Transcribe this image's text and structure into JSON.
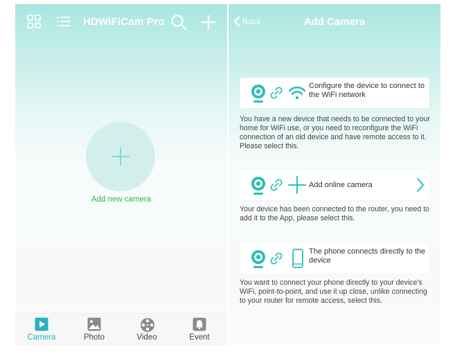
{
  "left": {
    "title": "HDWiFiCam Pro",
    "icons": [
      "grid-icon",
      "list-icon",
      "search-icon",
      "plus-icon"
    ],
    "add_label": "Add new camera",
    "tabs": [
      {
        "label": "Camera",
        "icon": "play-icon",
        "active": true
      },
      {
        "label": "Photo",
        "icon": "photo-icon",
        "active": false
      },
      {
        "label": "Video",
        "icon": "film-reel-icon",
        "active": false
      },
      {
        "label": "Event",
        "icon": "bell-icon",
        "active": false
      }
    ]
  },
  "right": {
    "back": "Back",
    "title": "Add Camera",
    "options": [
      {
        "title": "Configure the device to connect to the WiFi network",
        "icons": [
          "camera-icon",
          "link-icon",
          "wifi-icon"
        ],
        "description": "You have a new device that needs to be connected to your home for WiFi use, or you need to reconfigure the WiFi connection of an old device and have remote access to it. Please select this."
      },
      {
        "title": "Add online camera",
        "icons": [
          "camera-icon",
          "link-icon",
          "plus-icon",
          "chevron-right-icon"
        ],
        "description": "Your device has been connected to the router, you need to add it to the App, please select this."
      },
      {
        "title": "The phone connects directly to the device",
        "icons": [
          "camera-icon",
          "link-icon",
          "phone-icon"
        ],
        "description": "You want to connect your phone directly to your device's WiFi, point-to-point, and use it up close, unlike connecting to your router for remote access, select this."
      }
    ]
  },
  "colors": {
    "accent": "#27b0c5",
    "header": "#a9e6e0",
    "add_label": "#36b84e",
    "icon_teal": "#2bbfb5"
  }
}
